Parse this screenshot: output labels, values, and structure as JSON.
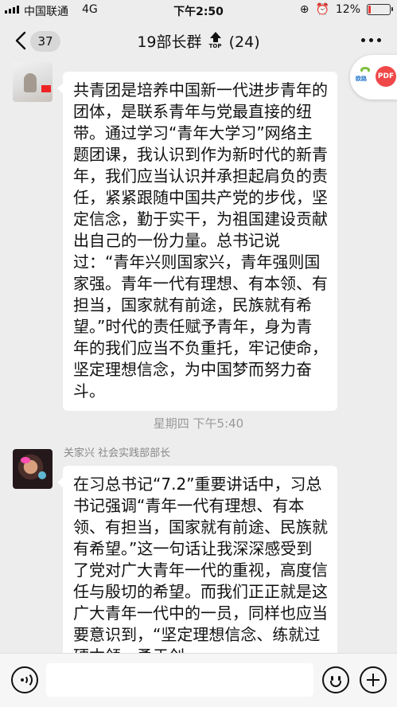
{
  "status_bar": {
    "carrier": "中国联通",
    "network": "4G",
    "time": "下午2:50",
    "battery": "12%",
    "battery_level": 0.12,
    "battery_color": "#e53935"
  },
  "nav": {
    "back_count": "37",
    "title": "19部长群",
    "top_badge": "TOP",
    "member_count": "(24)",
    "icons": [
      "back-chevron-icon",
      "top-arrow-icon",
      "more-dots-icon"
    ]
  },
  "messages": [
    {
      "sender": "",
      "text": "共青团是培养中国新一代进步青年的团体，是联系青年与党最直接的纽带。通过学习“青年大学习”网络主题团课，我认识到作为新时代的新青年，我们应当认识并承担起肩负的责任，紧紧跟随中国共产党的步伐，坚定信念，勤于实干，为祖国建设贡献出自己的一份力量。总书记说过：“青年兴则国家兴，青年强则国家强。青年一代有理想、有本领、有担当，国家就有前途，民族就有希望。”时代的责任赋予青年，身为青年的我们应当不负重托，牢记使命，坚定理想信念，为中国梦而努力奋斗。"
    },
    {
      "sender": "关家兴  社会实践部部长",
      "text": "在习总书记“7.2”重要讲话中，习总书记强调“青年一代有理想、有本领、有担当，国家就有前途、民族就有希望。”这一句话让我深深感受到了党对广大青年一代的重视，高度信任与殷切的希望。而我们正正就是这广大青年一代中的一员，同样也应当要意识到，“坚定理想信念、练就过硬本领、勇于创"
    }
  ],
  "time_divider": "星期四 下午5:40",
  "floating_widget": {
    "logo_label": "欧路",
    "pdf_label": "PDF",
    "accent": "#f04848"
  },
  "input_bar": {
    "placeholder": "",
    "icons": [
      "voice-icon",
      "emoji-icon",
      "add-icon"
    ]
  },
  "colors": {
    "background": "#ededed",
    "bubble": "#ffffff",
    "text": "#111111",
    "meta": "#9a9a9a"
  }
}
